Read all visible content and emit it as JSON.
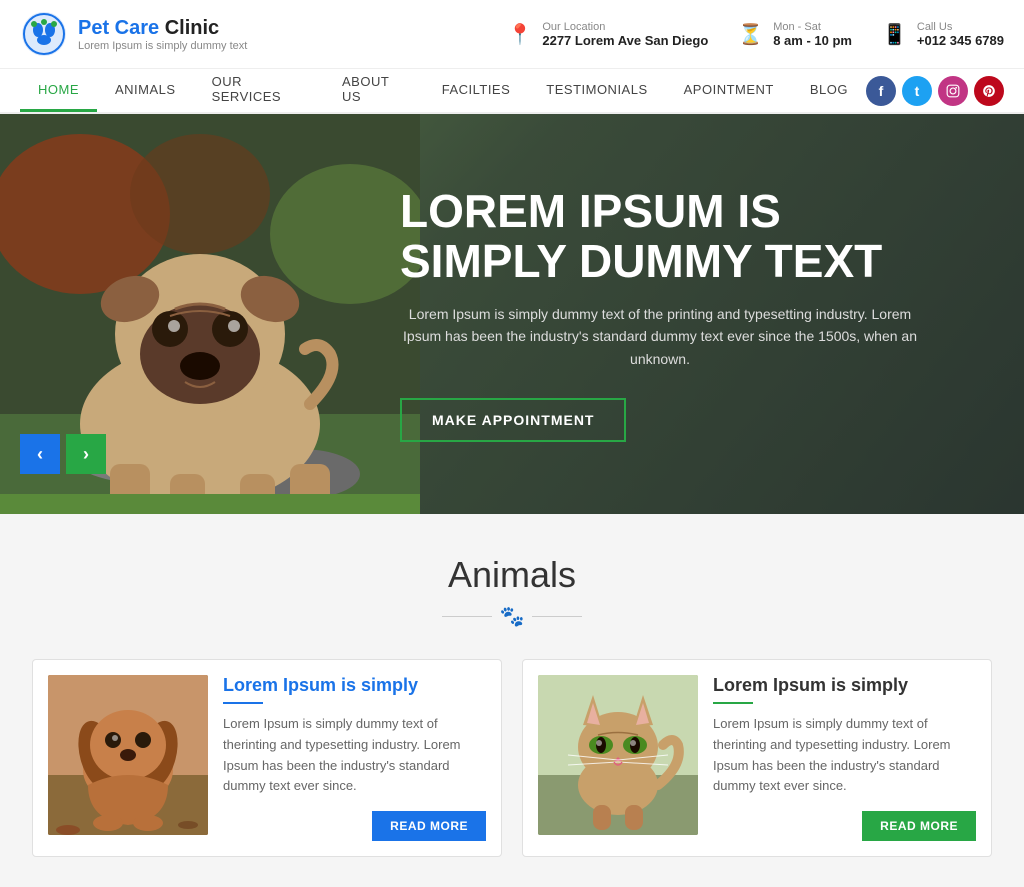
{
  "logo": {
    "brand": "Pet Care",
    "brand2": " Clinic",
    "tagline": "Lorem Ipsum is simply dummy text"
  },
  "header": {
    "location_label": "Our Location",
    "location_value": "2277 Lorem Ave San Diego",
    "hours_label": "Mon - Sat",
    "hours_value": "8 am - 10 pm",
    "phone_label": "Call Us",
    "phone_value": "+012 345 6789"
  },
  "nav": {
    "items": [
      {
        "label": "HOME",
        "active": true
      },
      {
        "label": "ANIMALS",
        "active": false
      },
      {
        "label": "OUR SERVICES",
        "active": false
      },
      {
        "label": "ABOUT US",
        "active": false
      },
      {
        "label": "FACILTIES",
        "active": false
      },
      {
        "label": "TESTIMONIALS",
        "active": false
      },
      {
        "label": "APOINTMENT",
        "active": false
      },
      {
        "label": "BLOG",
        "active": false
      }
    ]
  },
  "hero": {
    "title": "LOREM IPSUM IS SIMPLY DUMMY TEXT",
    "subtitle": "Lorem Ipsum is simply dummy text of the printing and typesetting industry. Lorem Ipsum has been the industry's standard dummy text ever since the 1500s, when an unknown.",
    "cta_label": "MAKE APPOINTMENT",
    "arrow_prev": "‹",
    "arrow_next": "›"
  },
  "animals_section": {
    "title": "Animals",
    "cards": [
      {
        "title": "Lorem Ipsum is simply",
        "title_color": "blue",
        "text": "Lorem Ipsum is simply dummy text of therinting and typesetting industry. Lorem Ipsum has been the industry's standard dummy text ever since.",
        "read_more": "READ MORE",
        "btn_color": "blue"
      },
      {
        "title": "Lorem Ipsum is simply",
        "title_color": "dark",
        "text": "Lorem Ipsum is simply dummy text of therinting and typesetting industry. Lorem Ipsum has been the industry's standard dummy text ever since.",
        "read_more": "READ MORE",
        "btn_color": "green"
      }
    ]
  }
}
